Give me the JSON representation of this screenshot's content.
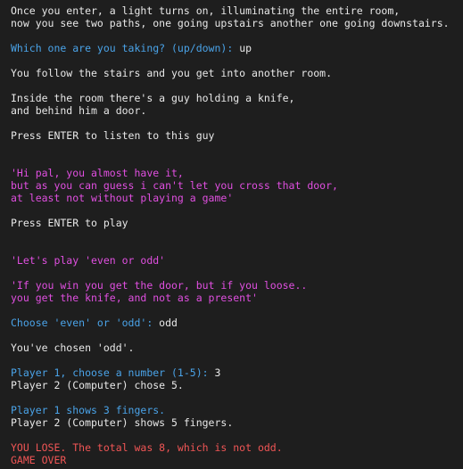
{
  "colors": {
    "background": "#1e1e1e",
    "text": "#e8e8e8",
    "prompt_blue": "#4aa3e8",
    "dialogue_magenta": "#e04fe0",
    "error_red": "#f05555"
  },
  "terminal": {
    "intro_1": "Once you enter, a light turns on, illuminating the entire room,",
    "intro_2": "now you see two paths, one going upstairs another one going downstairs.",
    "path_prompt": "Which one are you taking? (up/down): ",
    "path_answer": "up",
    "follow_stairs": "You follow the stairs and you get into another room.",
    "room_desc_1": "Inside the room there's a guy holding a knife,",
    "room_desc_2": "and behind him a door.",
    "press_enter_listen": "Press ENTER to listen to this guy",
    "guy_line_1": "'Hi pal, you almost have it,",
    "guy_line_2": "but as you can guess i can't let you cross that door,",
    "guy_line_3": "at least not without playing a game'",
    "press_enter_play": "Press ENTER to play",
    "lets_play": "'Let's play 'even or odd'",
    "rules_1": "'If you win you get the door, but if you loose..",
    "rules_2": "you get the knife, and not as a present'",
    "choice_prompt": "Choose 'even' or 'odd': ",
    "choice_answer": "odd",
    "chosen": "You've chosen 'odd'.",
    "p1_prompt": "Player 1, choose a number (1-5): ",
    "p1_answer": "3",
    "p2_chose": "Player 2 (Computer) chose 5.",
    "p1_shows": "Player 1 shows 3 fingers.",
    "p2_shows": "Player 2 (Computer) shows 5 fingers.",
    "lose": "YOU LOSE. The total was 8, which is not odd.",
    "game_over": "GAME OVER"
  }
}
